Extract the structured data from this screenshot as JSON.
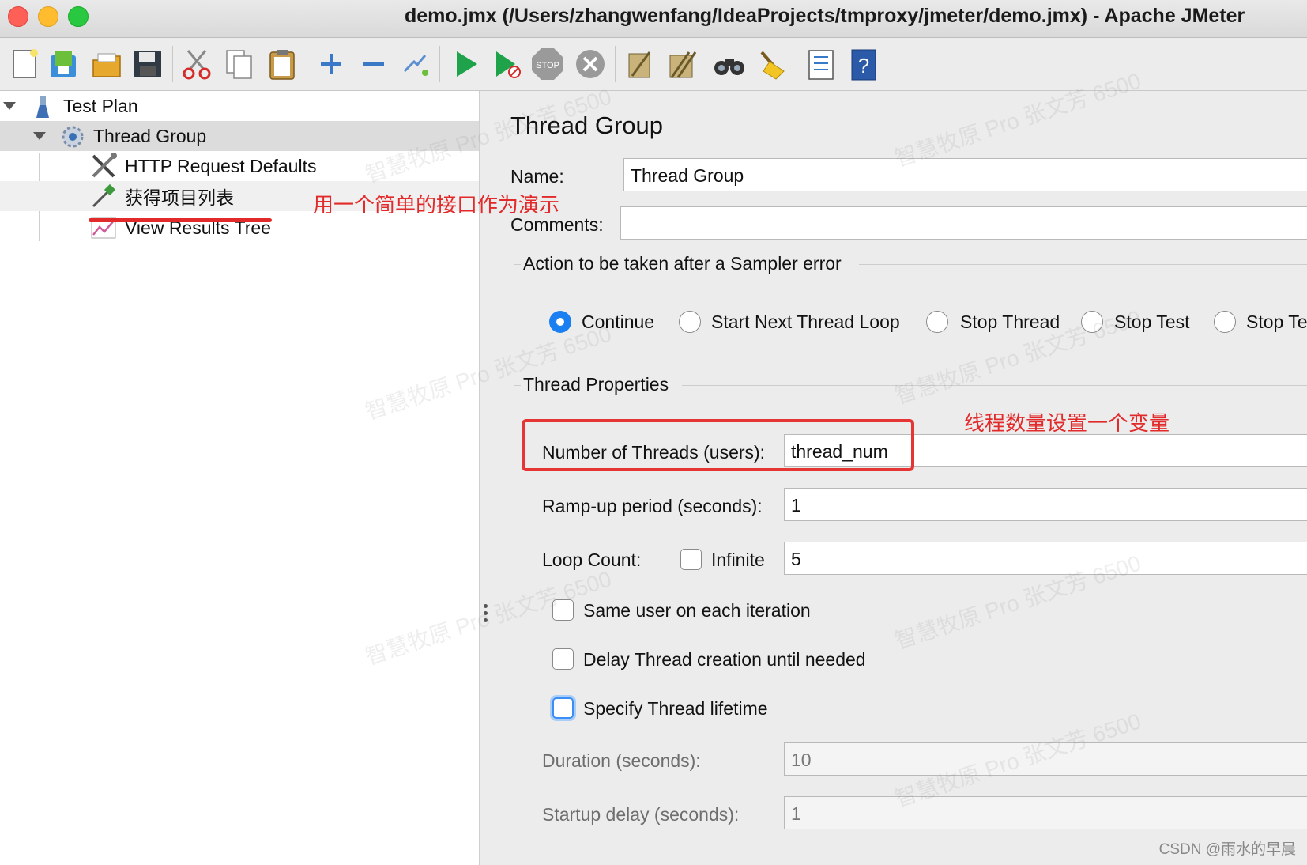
{
  "window": {
    "title": "demo.jmx (/Users/zhangwenfang/IdeaProjects/tmproxy/jmeter/demo.jmx) - Apache JMeter"
  },
  "toolbar": {
    "buttons": [
      "new-icon",
      "templates-icon",
      "open-icon",
      "save-icon",
      "cut-icon",
      "copy-icon",
      "paste-icon",
      "expand-icon",
      "collapse-icon",
      "toggle-icon",
      "start-icon",
      "start-no-pause-icon",
      "stop-icon",
      "shutdown-icon",
      "clear-icon",
      "clear-all-icon",
      "search-icon",
      "reset-search-icon",
      "function-helper-icon",
      "help-icon"
    ]
  },
  "tree": {
    "items": [
      {
        "label": "Test Plan",
        "icon": "test-plan-icon"
      },
      {
        "label": "Thread Group",
        "icon": "gear-icon"
      },
      {
        "label": "HTTP Request Defaults",
        "icon": "tools-icon"
      },
      {
        "label": "获得项目列表",
        "icon": "pipette-icon"
      },
      {
        "label": "View Results Tree",
        "icon": "graph-icon"
      }
    ]
  },
  "panel": {
    "heading": "Thread Group",
    "name_label": "Name:",
    "name_value": "Thread Group",
    "comments_label": "Comments:",
    "comments_value": "",
    "sampler_error_group": "Action to be taken after a Sampler error",
    "sampler_error_options": [
      "Continue",
      "Start Next Thread Loop",
      "Stop Thread",
      "Stop Test",
      "Stop Test Now"
    ],
    "sampler_error_selected": "Continue",
    "thread_props_group": "Thread Properties",
    "threads_label": "Number of Threads (users):",
    "threads_value": "thread_num",
    "rampup_label": "Ramp-up period (seconds):",
    "rampup_value": "1",
    "loop_label": "Loop Count:",
    "infinite_label": "Infinite",
    "loop_value": "5",
    "same_user_label": "Same user on each iteration",
    "delay_label": "Delay Thread creation until needed",
    "lifetime_label": "Specify Thread lifetime",
    "duration_label": "Duration (seconds):",
    "duration_value": "10",
    "startup_label": "Startup delay (seconds):",
    "startup_value": "1"
  },
  "annotations": {
    "tree_note": "用一个简单的接口作为演示",
    "threads_note": "线程数量设置一个变量",
    "color": "#e32a2a"
  },
  "credit": "CSDN @雨水的早晨",
  "watermark_text": "智慧牧原 Pro 张文芳 6500"
}
